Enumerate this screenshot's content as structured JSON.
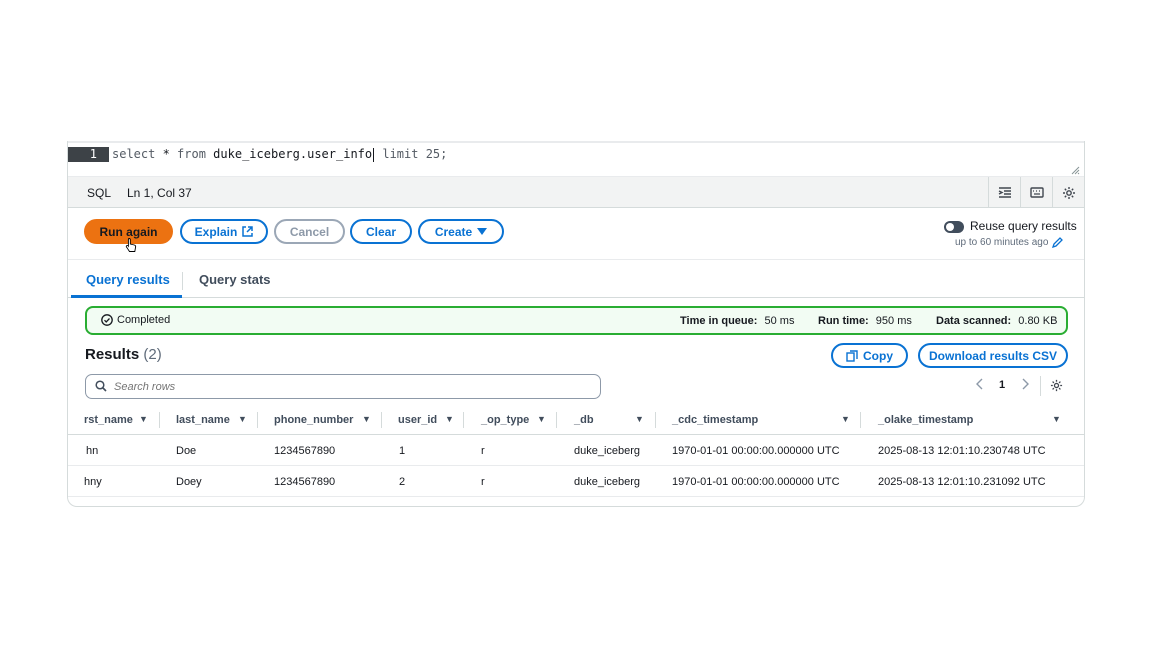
{
  "editor": {
    "line_number": "1",
    "query": {
      "p1": "select",
      "p2": " * ",
      "p3": "from",
      "p4": " duke_iceberg.user_info",
      "p5": " limit 25;"
    }
  },
  "statusbar": {
    "language": "SQL",
    "cursor_position": "Ln 1, Col 37"
  },
  "actions": {
    "run_again": "Run again",
    "explain": "Explain",
    "cancel": "Cancel",
    "clear": "Clear",
    "create": "Create",
    "reuse_label": "Reuse query results",
    "reuse_sub": "up to 60 minutes ago",
    "reuse_enabled": false
  },
  "tabs": [
    {
      "label": "Query results",
      "active": true
    },
    {
      "label": "Query stats",
      "active": false
    }
  ],
  "status": {
    "state": "Completed",
    "time_in_queue_label": "Time in queue:",
    "time_in_queue_value": "50 ms",
    "run_time_label": "Run time:",
    "run_time_value": "950 ms",
    "data_scanned_label": "Data scanned:",
    "data_scanned_value": "0.80 KB",
    "color": "#29ad32"
  },
  "results": {
    "title": "Results",
    "count": "(2)",
    "copy": "Copy",
    "download": "Download results CSV",
    "search_placeholder": "Search rows",
    "page": "1"
  },
  "table": {
    "columns": [
      "rst_name",
      "last_name",
      "phone_number",
      "user_id",
      "_op_type",
      "_db",
      "_cdc_timestamp",
      "_olake_timestamp"
    ],
    "rows": [
      [
        "hn",
        "Doe",
        "1234567890",
        "1",
        "r",
        "duke_iceberg",
        "1970-01-01 00:00:00.000000 UTC",
        "2025-08-13 12:01:10.230748 UTC"
      ],
      [
        "hny",
        "Doey",
        "1234567890",
        "2",
        "r",
        "duke_iceberg",
        "1970-01-01 00:00:00.000000 UTC",
        "2025-08-13 12:01:10.231092 UTC"
      ]
    ]
  },
  "colors": {
    "accent": "#0972d3",
    "primary_button": "#ec7211"
  }
}
